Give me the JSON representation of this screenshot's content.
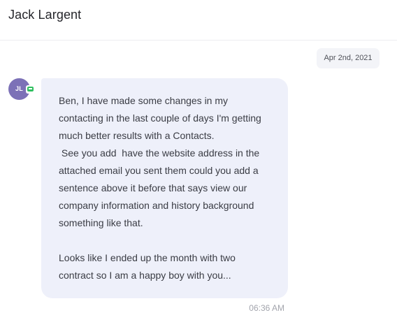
{
  "header": {
    "title": "Jack Largent"
  },
  "conversation": {
    "date_label": "Apr 2nd, 2021",
    "message": {
      "sender_initials": "JL",
      "channel_icon": "sms-chat-icon",
      "text": "Ben, I have made some changes in my\ncontacting in the last couple of days I'm getting\nmuch better results with a Contacts.\n See you add  have the website address in the\nattached email you sent them could you add a\nsentence above it before that says view our\ncompany information and history background\nsomething like that.\n\nLooks like I ended up the month with two\ncontract so I am a happy boy with you...",
      "time": "06:36 AM"
    }
  },
  "colors": {
    "avatar": "#7c71b7",
    "bubble": "#eef0fa",
    "channel_badge": "#2fbf5f"
  }
}
